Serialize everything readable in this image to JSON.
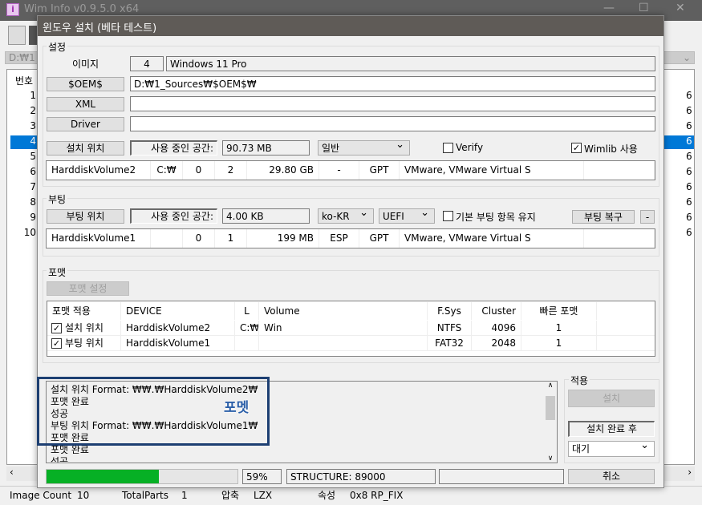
{
  "main_window": {
    "title": "Wim Info v0.9.5.0 x64",
    "path": "D:₩1",
    "list_header": "번호",
    "rows": [
      "1",
      "2",
      "3",
      "4",
      "5",
      "6",
      "7",
      "8",
      "9",
      "10"
    ],
    "right_col": "6",
    "selected_row": 4,
    "status": {
      "image_count_label": "Image Count",
      "image_count": "10",
      "total_parts_label": "TotalParts",
      "total_parts": "1",
      "compress_label": "압축",
      "compress": "LZX",
      "attr_label": "속성",
      "attr": "0x8 RP_FIX"
    }
  },
  "dialog": {
    "title": "윈도우 설치 (베타 테스트)",
    "settings": {
      "label": "설정",
      "image_label": "이미지",
      "image_index": "4",
      "image_name": "Windows 11 Pro",
      "oem_button": "$OEM$",
      "oem_path": "D:₩1_Sources₩$OEM$₩",
      "xml_button": "XML",
      "xml_path": "",
      "driver_button": "Driver",
      "driver_path": "",
      "install_location_button": "설치 위치",
      "used_space_label": "사용 중인 공간:",
      "used_space": "90.73 MB",
      "mode": "일반",
      "verify_label": "Verify",
      "verify_checked": false,
      "wimlib_label": "Wimlib 사용",
      "wimlib_checked": true,
      "volume": [
        "HarddiskVolume2",
        "C:₩",
        "0",
        "2",
        "29.80 GB",
        "-",
        "GPT",
        "VMware, VMware Virtual S"
      ]
    },
    "boot": {
      "label": "부팅",
      "boot_location_button": "부팅 위치",
      "used_space_label": "사용 중인 공간:",
      "used_space": "4.00 KB",
      "locale": "ko-KR",
      "firmware": "UEFI",
      "keep_default_label": "기본 부팅 항목 유지",
      "keep_default_checked": false,
      "repair_button": "부팅 복구",
      "minus_button": "-",
      "volume": [
        "HarddiskVolume1",
        "",
        "0",
        "1",
        "199 MB",
        "ESP",
        "GPT",
        "VMware, VMware Virtual S"
      ]
    },
    "format": {
      "label": "포맷",
      "settings_button": "포맷 설정",
      "columns": [
        "포맷 적용",
        "DEVICE",
        "L",
        "Volume",
        "F.Sys",
        "Cluster",
        "빠른 포맷"
      ],
      "rows": [
        {
          "checked": true,
          "apply": "설치 위치",
          "device": "HarddiskVolume2",
          "letter": "C:₩",
          "volume": "Win",
          "fs": "NTFS",
          "cluster": "4096",
          "quick": "1"
        },
        {
          "checked": true,
          "apply": "부팅 위치",
          "device": "HarddiskVolume1",
          "letter": "",
          "volume": "",
          "fs": "FAT32",
          "cluster": "2048",
          "quick": "1"
        }
      ]
    },
    "log": [
      "설치 위치 Format: ₩₩.₩HarddiskVolume2₩",
      "포맷 완료",
      "성공",
      "부팅 위치 Format: ₩₩.₩HarddiskVolume1₩",
      "포맷 완료",
      "포맷 완료",
      "성공"
    ],
    "annotation": "포멧",
    "apply": {
      "label": "적용",
      "install_button": "설치",
      "after_label": "설치 완료 후",
      "after_action": "대기"
    },
    "progress": {
      "percent": 59,
      "percent_text": "59%",
      "status": "STRUCTURE: 89000",
      "extra": ""
    },
    "cancel_button": "취소",
    "colors": {
      "progress": "#06b025",
      "selection": "#0078d7",
      "highlight": "#1d3f72"
    }
  }
}
